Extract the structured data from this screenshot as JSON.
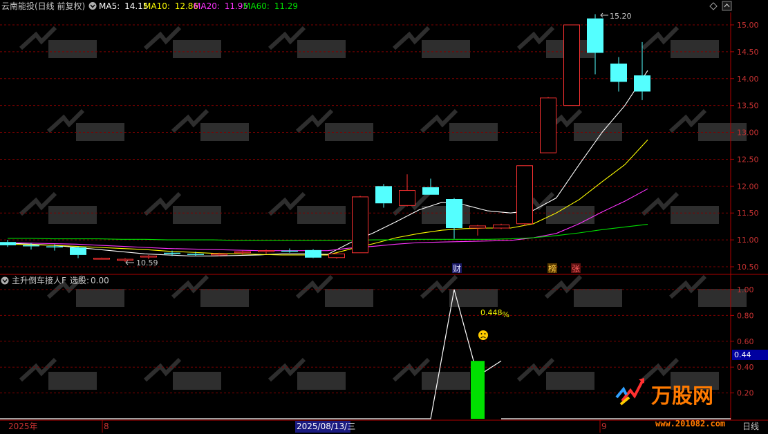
{
  "header": {
    "stock_name": "云南能投",
    "period_label": "(日线 前复权)",
    "ma": [
      {
        "label": "MA5:",
        "value": "14.15",
        "color": "#ffffff"
      },
      {
        "label": "MA10:",
        "value": "12.86",
        "color": "#ffff00"
      },
      {
        "label": "MA20:",
        "value": "11.95",
        "color": "#ff33ff"
      },
      {
        "label": "MA60:",
        "value": "11.29",
        "color": "#00e000"
      }
    ]
  },
  "indicator": {
    "name": "主升倒车接人F",
    "select_label": "选股:",
    "select_value": "0.00",
    "percent_label": "0.448",
    "percent_suffix": "%",
    "current_value_label": "0.44"
  },
  "x_axis": {
    "start_label": "2025年",
    "month_label_1": "8",
    "crosshair_label": "2025/08/13/三",
    "month_label_2": "9",
    "period_label": "日线"
  },
  "markers": {
    "cai": "财",
    "bang": "榜",
    "zhang": "张",
    "high_label": "15.20",
    "low_label": "10.59"
  },
  "colors": {
    "up": "#ff3232",
    "down": "#54ffff",
    "grid": "#800000",
    "axis": "#b00000"
  },
  "chart_data": {
    "type": "candlestick",
    "price_axis": {
      "ticks": [
        "10.50",
        "11.00",
        "11.50",
        "12.00",
        "12.50",
        "13.00",
        "13.50",
        "14.00",
        "14.50",
        "15.00"
      ],
      "ylim": [
        10.4,
        15.3
      ]
    },
    "indicator_axis": {
      "ticks": [
        "0.20",
        "0.40",
        "0.60",
        "0.80",
        "1.00"
      ],
      "ylim": [
        0,
        1.1
      ]
    },
    "candles": [
      {
        "o": 10.96,
        "h": 11.0,
        "l": 10.87,
        "c": 10.9
      },
      {
        "o": 10.9,
        "h": 10.94,
        "l": 10.82,
        "c": 10.88
      },
      {
        "o": 10.88,
        "h": 10.92,
        "l": 10.8,
        "c": 10.86
      },
      {
        "o": 10.86,
        "h": 10.88,
        "l": 10.66,
        "c": 10.72
      },
      {
        "o": 10.65,
        "h": 10.67,
        "l": 10.64,
        "c": 10.66
      },
      {
        "o": 10.62,
        "h": 10.66,
        "l": 10.59,
        "c": 10.64
      },
      {
        "o": 10.68,
        "h": 10.72,
        "l": 10.64,
        "c": 10.7
      },
      {
        "o": 10.76,
        "h": 10.8,
        "l": 10.7,
        "c": 10.74
      },
      {
        "o": 10.74,
        "h": 10.78,
        "l": 10.7,
        "c": 10.73
      },
      {
        "o": 10.72,
        "h": 10.76,
        "l": 10.7,
        "c": 10.74
      },
      {
        "o": 10.76,
        "h": 10.8,
        "l": 10.72,
        "c": 10.78
      },
      {
        "o": 10.78,
        "h": 10.82,
        "l": 10.74,
        "c": 10.8
      },
      {
        "o": 10.8,
        "h": 10.84,
        "l": 10.76,
        "c": 10.78
      },
      {
        "o": 10.81,
        "h": 10.83,
        "l": 10.66,
        "c": 10.67
      },
      {
        "o": 10.67,
        "h": 10.76,
        "l": 10.65,
        "c": 10.74
      },
      {
        "o": 10.76,
        "h": 11.82,
        "l": 10.76,
        "c": 11.8
      },
      {
        "o": 12.0,
        "h": 12.04,
        "l": 11.6,
        "c": 11.68
      },
      {
        "o": 11.64,
        "h": 12.22,
        "l": 11.62,
        "c": 11.92
      },
      {
        "o": 11.98,
        "h": 12.14,
        "l": 11.84,
        "c": 11.84
      },
      {
        "o": 11.76,
        "h": 11.78,
        "l": 11.02,
        "c": 11.22
      },
      {
        "o": 11.22,
        "h": 11.28,
        "l": 11.08,
        "c": 11.26
      },
      {
        "o": 11.22,
        "h": 11.3,
        "l": 11.2,
        "c": 11.28
      },
      {
        "o": 11.3,
        "h": 12.38,
        "l": 11.26,
        "c": 12.38
      },
      {
        "o": 12.62,
        "h": 13.66,
        "l": 12.62,
        "c": 13.64
      },
      {
        "o": 13.5,
        "h": 15.0,
        "l": 13.5,
        "c": 15.0
      },
      {
        "o": 15.12,
        "h": 15.2,
        "l": 14.08,
        "c": 14.48
      },
      {
        "o": 14.28,
        "h": 14.4,
        "l": 13.76,
        "c": 13.94
      },
      {
        "o": 14.06,
        "h": 14.68,
        "l": 13.6,
        "c": 13.76
      }
    ],
    "series": [
      {
        "name": "MA5",
        "values": [
          10.94,
          10.92,
          10.9,
          10.86,
          10.82,
          10.78,
          10.74,
          10.72,
          10.7,
          10.7,
          10.71,
          10.72,
          10.74,
          10.74,
          10.73,
          10.95,
          11.13,
          11.34,
          11.56,
          11.7,
          11.65,
          11.54,
          11.5,
          11.55,
          11.78,
          12.4,
          13.0,
          13.5,
          14.15
        ],
        "color": "#ffffff"
      },
      {
        "name": "MA10",
        "values": [
          10.92,
          10.91,
          10.9,
          10.88,
          10.86,
          10.84,
          10.82,
          10.79,
          10.77,
          10.75,
          10.74,
          10.73,
          10.72,
          10.72,
          10.72,
          10.83,
          10.93,
          11.04,
          11.12,
          11.18,
          11.21,
          11.22,
          11.22,
          11.3,
          11.5,
          11.75,
          12.08,
          12.4,
          12.86
        ],
        "color": "#ffff00"
      },
      {
        "name": "MA20",
        "values": [
          10.95,
          10.94,
          10.93,
          10.92,
          10.9,
          10.88,
          10.86,
          10.84,
          10.83,
          10.82,
          10.81,
          10.8,
          10.8,
          10.8,
          10.8,
          10.85,
          10.88,
          10.92,
          10.95,
          10.96,
          10.97,
          10.98,
          10.99,
          11.04,
          11.12,
          11.3,
          11.52,
          11.72,
          11.95
        ],
        "color": "#ff33ff"
      },
      {
        "name": "MA60",
        "values": [
          11.03,
          11.03,
          11.02,
          11.02,
          11.02,
          11.01,
          11.01,
          11.0,
          11.0,
          11.0,
          10.99,
          10.99,
          10.99,
          10.99,
          10.99,
          10.99,
          11.0,
          11.0,
          11.01,
          11.01,
          11.01,
          11.01,
          11.02,
          11.04,
          11.08,
          11.13,
          11.19,
          11.24,
          11.29
        ],
        "color": "#00e000"
      }
    ],
    "indicator_line": {
      "indices": [
        18,
        19,
        20,
        21
      ],
      "values": [
        0,
        1.0,
        0.33,
        0.448
      ]
    },
    "indicator_bar": {
      "index": 20,
      "value": 0.448
    }
  }
}
